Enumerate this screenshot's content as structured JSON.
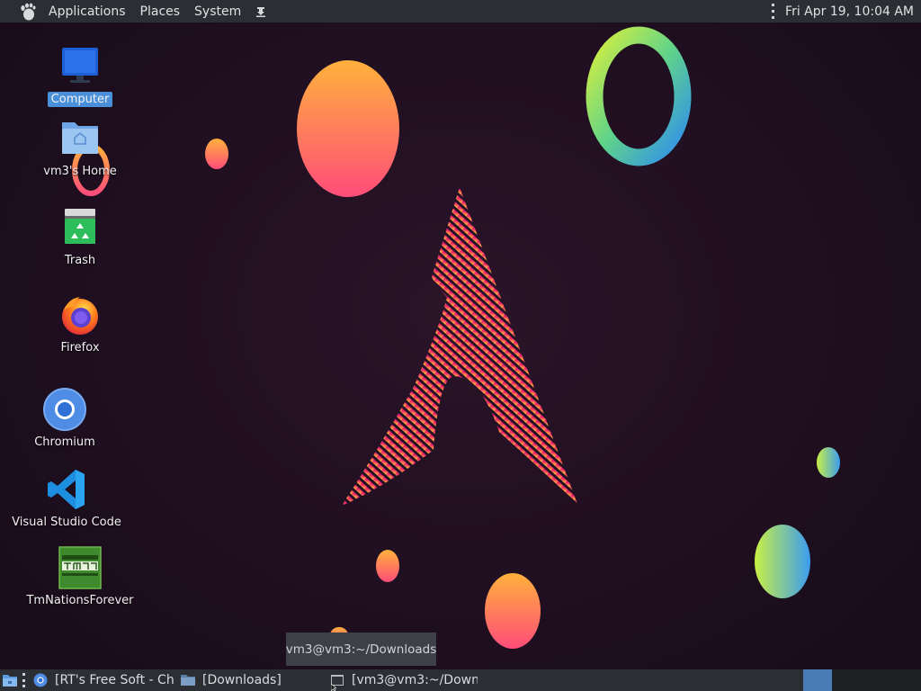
{
  "top_panel": {
    "menus": [
      "Applications",
      "Places",
      "System"
    ],
    "clock": "Fri Apr 19, 10:04 AM",
    "icons": {
      "logo": "gnome-foot-icon",
      "launcher": "download-arrow-icon"
    }
  },
  "desktop": {
    "icons": [
      {
        "label": "Computer",
        "icon": "computer-icon",
        "selected": true
      },
      {
        "label": "vm3's Home",
        "icon": "home-folder-icon"
      },
      {
        "label": "Trash",
        "icon": "trash-icon"
      },
      {
        "label": "Firefox",
        "icon": "firefox-icon"
      },
      {
        "label": "Chromium",
        "icon": "chromium-icon"
      },
      {
        "label": "Visual Studio Code",
        "icon": "vscode-icon"
      },
      {
        "label": "TmNationsForever",
        "icon": "tmnations-icon"
      }
    ]
  },
  "tooltip": "vm3@vm3:~/Downloads",
  "taskbar": {
    "tasks": [
      {
        "label": "[RT's Free Soft - Ch...",
        "icon": "chromium-icon"
      },
      {
        "label": "[Downloads]",
        "icon": "folder-icon"
      },
      {
        "label": "[vm3@vm3:~/Down...",
        "icon": "terminal-icon"
      }
    ],
    "workspaces": 2,
    "active_workspace": 1
  },
  "colors": {
    "panel": "#2b2e33",
    "selection": "#4a8fd9",
    "workspace_active": "#4a7bb5",
    "wallpaper": "#1f0f20"
  }
}
